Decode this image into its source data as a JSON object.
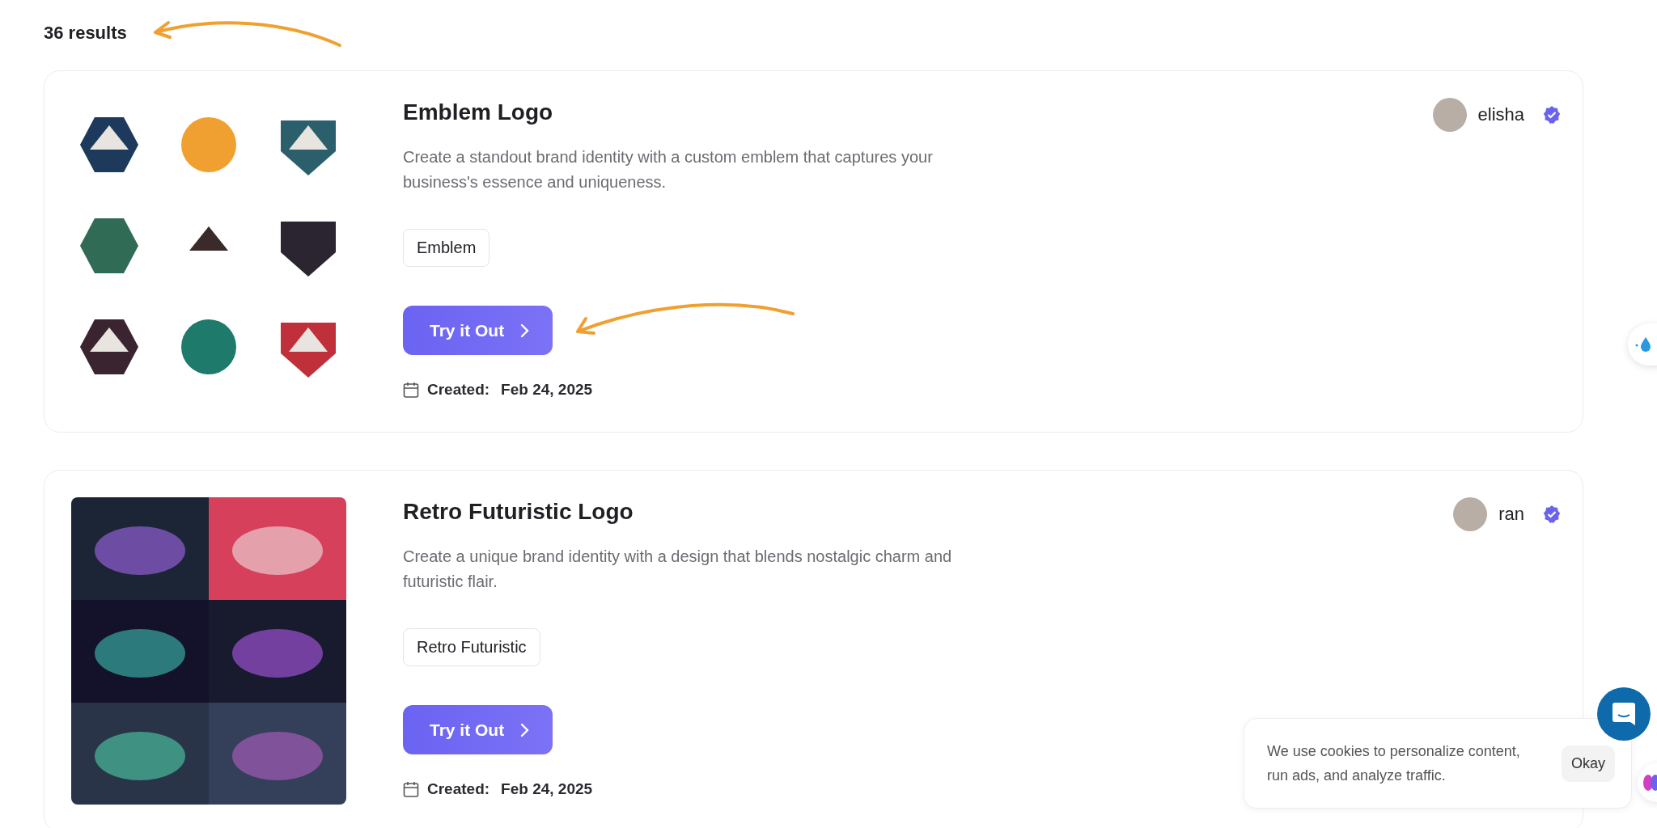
{
  "results_count": "36 results",
  "cards": [
    {
      "title": "Emblem Logo",
      "description": "Create a standout brand identity with a custom emblem that captures your business's essence and uniqueness.",
      "tag": "Emblem",
      "button": "Try it Out",
      "created_label": "Created:",
      "created_date": "Feb 24, 2025",
      "author": "elisha",
      "preview": {
        "kind": "emblems"
      }
    },
    {
      "title": "Retro Futuristic Logo",
      "description": "Create a unique brand identity with a design that blends nostalgic charm and futuristic flair.",
      "tag": "Retro Futuristic",
      "button": "Try it Out",
      "created_label": "Created:",
      "created_date": "Feb 24, 2025",
      "author": "ran",
      "preview": {
        "kind": "tiles"
      }
    }
  ],
  "cookie_banner": {
    "text": "We use cookies to personalize content, run ads, and analyze traffic.",
    "button": "Okay"
  }
}
